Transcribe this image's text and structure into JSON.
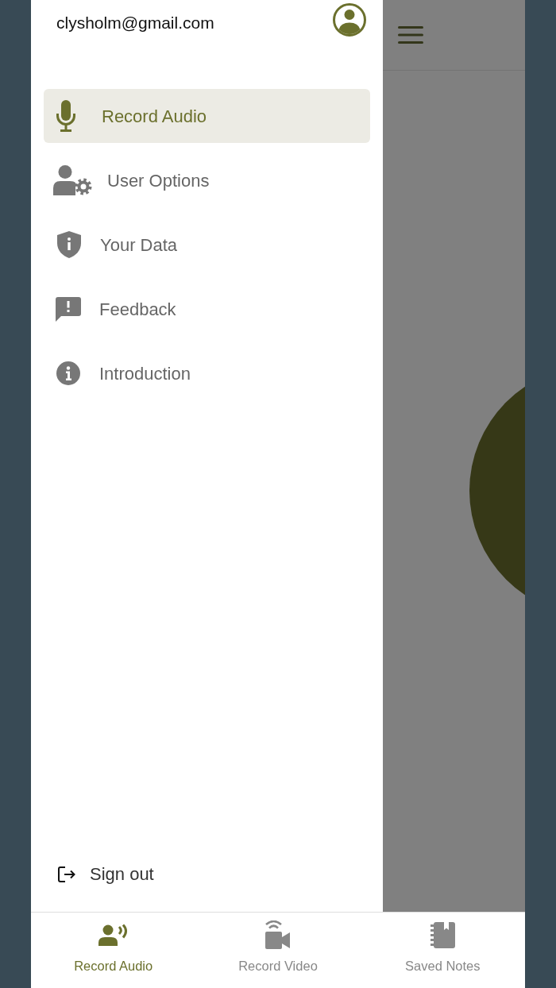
{
  "drawer": {
    "account": {
      "email": "clysholm@gmail.com"
    },
    "menu_items": [
      {
        "label": "Record Audio",
        "selected": true
      },
      {
        "label": "User Options",
        "selected": false
      },
      {
        "label": "Your Data",
        "selected": false
      },
      {
        "label": "Feedback",
        "selected": false
      },
      {
        "label": "Introduction",
        "selected": false
      }
    ],
    "sign_out": {
      "label": "Sign out"
    }
  },
  "tab_bar": {
    "tabs": [
      {
        "label": "Record Audio",
        "selected": true
      },
      {
        "label": "Record Video",
        "selected": false
      },
      {
        "label": "Saved Notes",
        "selected": false
      }
    ]
  }
}
